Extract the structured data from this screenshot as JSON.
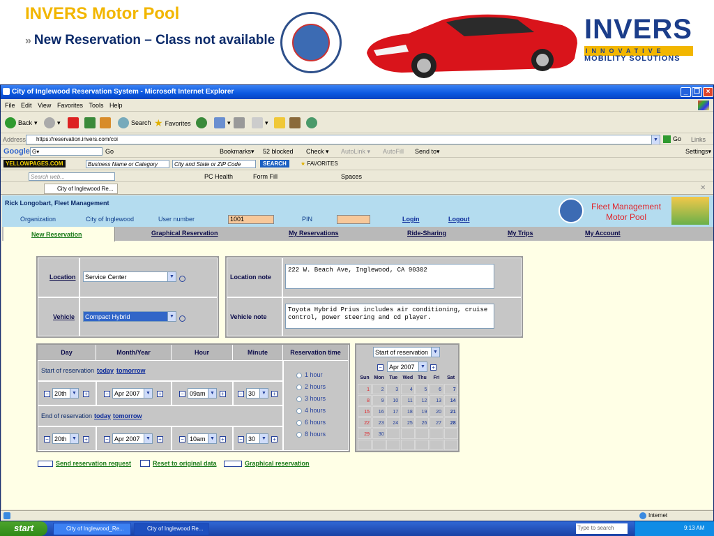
{
  "slide": {
    "title": "INVERS Motor Pool",
    "subtitle_prefix": "»",
    "subtitle": "New Reservation – Class not available",
    "logo_word": "INVERS",
    "logo_tag": "INNOVATIVE",
    "logo_tag2": "MOBILITY SOLUTIONS"
  },
  "window": {
    "title": "City of Inglewood Reservation System - Microsoft Internet Explorer",
    "menus": [
      "File",
      "Edit",
      "View",
      "Favorites",
      "Tools",
      "Help"
    ],
    "toolbar": {
      "back": "Back",
      "search": "Search",
      "favorites": "Favorites"
    },
    "address": {
      "label": "Address",
      "url": "https://reservation.invers.com/coi",
      "go": "Go",
      "links": "Links"
    },
    "googlebar": {
      "go": "Go",
      "bookmarks": "Bookmarks▾",
      "blocked": "52 blocked",
      "check": "Check ▾",
      "autolink": "AutoLink ▾",
      "autofill": "AutoFill",
      "sendto": "Send to▾",
      "settings": "Settings▾"
    },
    "ypbar": {
      "brand": "YELLOWPAGES.COM",
      "category": "Business Name or Category",
      "city": "City and State or ZIP Code",
      "search": "SEARCH",
      "favorites": "FAVORITES"
    },
    "livebar": {
      "search_placeholder": "Search web...",
      "pchealth": "PC Health",
      "formfill": "Form Fill",
      "spaces": "Spaces"
    },
    "tab": "City of Inglewood Re...",
    "status_zone": "Internet"
  },
  "app": {
    "user_name": "Rick Longobart, Fleet Management",
    "org_label": "Organization",
    "org_value": "City of Inglewood",
    "user_number_label": "User number",
    "user_number_value": "1001",
    "pin_label": "PIN",
    "login": "Login",
    "logout": "Logout",
    "brand_line1": "Fleet Management",
    "brand_line2": "Motor Pool",
    "nav": [
      "New Reservation",
      "Graphical Reservation",
      "My Reservations",
      "Ride-Sharing",
      "My Trips",
      "My Account"
    ]
  },
  "form": {
    "location_label": "Location",
    "location_value": "Service Center",
    "vehicle_label": "Vehicle",
    "vehicle_value": "Compact Hybrid",
    "location_note_label": "Location note",
    "location_note": "222 W. Beach Ave, Inglewood, CA 90302",
    "vehicle_note_label": "Vehicle note",
    "vehicle_note": "Toyota Hybrid Prius includes air conditioning, cruise control, power steering and cd player."
  },
  "time": {
    "headers": [
      "Day",
      "Month/Year",
      "Hour",
      "Minute",
      "Reservation time"
    ],
    "start_label": "Start of reservation",
    "end_label": "End of reservation",
    "today": "today",
    "tomorrow": "tomorrow",
    "start": {
      "day": "20th",
      "month": "Apr 2007",
      "hour": "09am",
      "minute": "30"
    },
    "end": {
      "day": "20th",
      "month": "Apr 2007",
      "hour": "10am",
      "minute": "30"
    },
    "durations": [
      "1 hour",
      "2 hours",
      "3 hours",
      "4 hours",
      "6 hours",
      "8 hours"
    ]
  },
  "calendar": {
    "mode": "Start of reservation",
    "month": "Apr 2007",
    "weekdays": [
      "Sun",
      "Mon",
      "Tue",
      "Wed",
      "Thu",
      "Fri",
      "Sat"
    ],
    "weeks": [
      [
        "1",
        "2",
        "3",
        "4",
        "5",
        "6",
        "7"
      ],
      [
        "8",
        "9",
        "10",
        "11",
        "12",
        "13",
        "14"
      ],
      [
        "15",
        "16",
        "17",
        "18",
        "19",
        "20",
        "21"
      ],
      [
        "22",
        "23",
        "24",
        "25",
        "26",
        "27",
        "28"
      ],
      [
        "29",
        "30",
        "",
        "",
        "",
        "",
        ""
      ],
      [
        "",
        "",
        "",
        "",
        "",
        "",
        ""
      ]
    ],
    "sunday_color": "#e0252b"
  },
  "actions": {
    "send": "Send reservation request",
    "reset": "Reset to original data",
    "graphical": "Graphical reservation"
  },
  "taskbar": {
    "start": "start",
    "items": [
      "City of Inglewood_Re...",
      "City of Inglewood Re..."
    ],
    "search_placeholder": "Type to search",
    "time": "9:13 AM"
  },
  "colors": {
    "title_gold": "#f2b600",
    "brand_blue": "#1b3d8a",
    "header_blue": "#b4dcef",
    "content_bg": "#ffffe6"
  }
}
